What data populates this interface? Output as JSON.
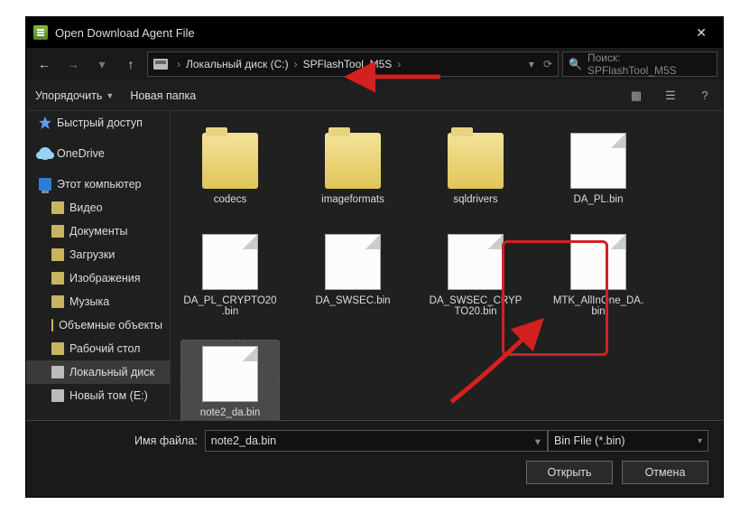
{
  "title": "Open Download Agent File",
  "breadcrumb": {
    "drive": "Локальный диск (C:)",
    "folder": "SPFlashTool_M5S"
  },
  "search": {
    "placeholder": "Поиск: SPFlashTool_M5S"
  },
  "toolbar": {
    "organize": "Упорядочить",
    "newfolder": "Новая папка"
  },
  "sidebar": {
    "items": [
      {
        "label": "Быстрый доступ",
        "icon": "ic-quick"
      },
      {
        "label": "OneDrive",
        "icon": "ic-cloud"
      },
      {
        "label": "Этот компьютер",
        "icon": "ic-pc"
      },
      {
        "label": "Видео",
        "icon": "ic-folder",
        "child": true
      },
      {
        "label": "Документы",
        "icon": "ic-folder",
        "child": true
      },
      {
        "label": "Загрузки",
        "icon": "ic-folder",
        "child": true
      },
      {
        "label": "Изображения",
        "icon": "ic-folder",
        "child": true
      },
      {
        "label": "Музыка",
        "icon": "ic-folder",
        "child": true
      },
      {
        "label": "Объемные объекты",
        "icon": "ic-folder",
        "child": true
      },
      {
        "label": "Рабочий стол",
        "icon": "ic-folder",
        "child": true
      },
      {
        "label": "Локальный диск",
        "icon": "ic-drive",
        "child": true,
        "active": true
      },
      {
        "label": "Новый том (E:)",
        "icon": "ic-drive",
        "child": true
      }
    ]
  },
  "files": [
    {
      "name": "codecs",
      "type": "folder"
    },
    {
      "name": "imageformats",
      "type": "folder"
    },
    {
      "name": "sqldrivers",
      "type": "folder"
    },
    {
      "name": "DA_PL.bin",
      "type": "file"
    },
    {
      "name": "DA_PL_CRYPTO20.bin",
      "type": "file"
    },
    {
      "name": "DA_SWSEC.bin",
      "type": "file"
    },
    {
      "name": "DA_SWSEC_CRYPTO20.bin",
      "type": "file"
    },
    {
      "name": "MTK_AllInOne_DA.bin",
      "type": "file"
    },
    {
      "name": "note2_da.bin",
      "type": "file",
      "selected": true
    }
  ],
  "bottom": {
    "filename_label": "Имя файла:",
    "filename_value": "note2_da.bin",
    "filetype": "Bin File (*.bin)",
    "open": "Открыть",
    "cancel": "Отмена"
  }
}
